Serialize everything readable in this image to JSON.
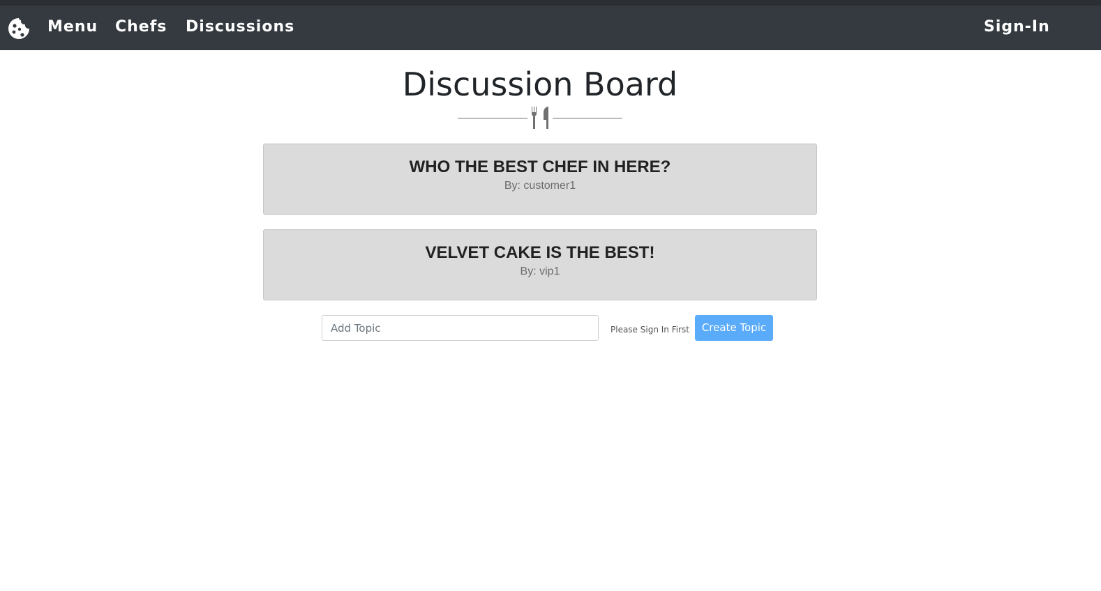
{
  "nav": {
    "logo_icon": "cookie-icon",
    "items": [
      {
        "label": "Menu"
      },
      {
        "label": "Chefs"
      },
      {
        "label": "Discussions"
      }
    ],
    "signin_label": "Sign-In"
  },
  "header": {
    "title": "Discussion Board",
    "divider_icon": "utensils-icon"
  },
  "topics": [
    {
      "title": "WHO THE BEST CHEF IN HERE?",
      "author": "By: customer1"
    },
    {
      "title": "VELVET CAKE IS THE BEST!",
      "author": "By: vip1"
    }
  ],
  "form": {
    "placeholder": "Add Topic",
    "value": "",
    "hint": "Please Sign In First",
    "button_label": "Create Topic"
  },
  "colors": {
    "navbar": "#343a40",
    "card_bg": "#dbdbdb",
    "button": "#5aabf9"
  }
}
